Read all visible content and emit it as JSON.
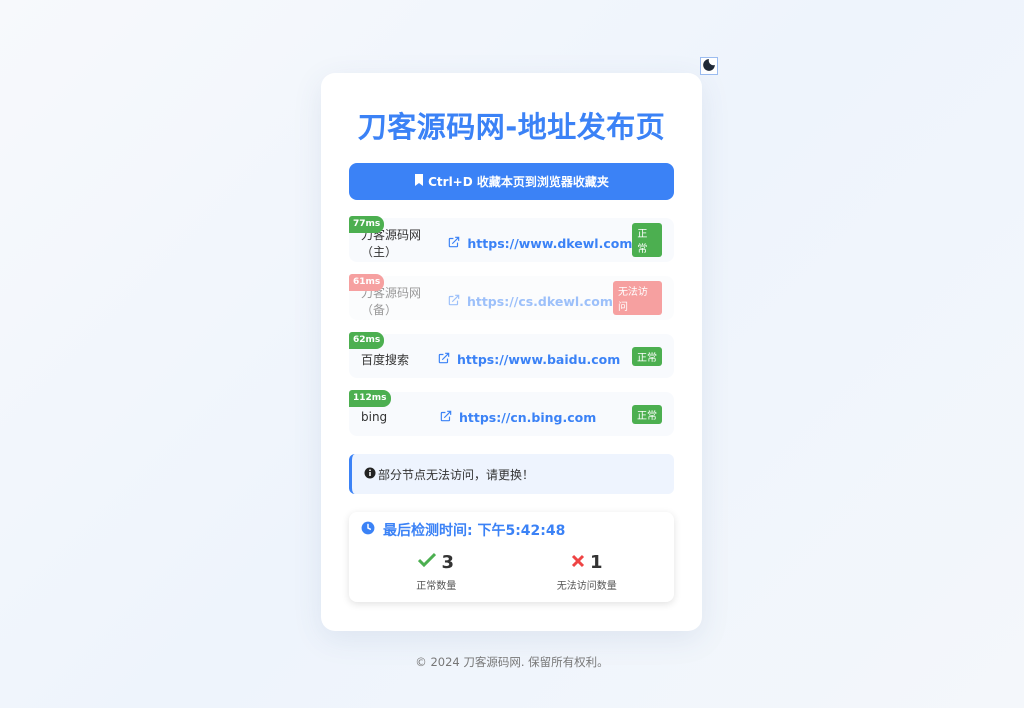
{
  "header": {
    "title": "刀客源码网-地址发布页",
    "theme_toggle_icon": "moon-icon"
  },
  "bookmark": {
    "label": "Ctrl+D 收藏本页到浏览器收藏夹",
    "icon": "bookmark-icon"
  },
  "sites": [
    {
      "latency": "77ms",
      "name": "刀客源码网（主）",
      "url": "https://www.dkewl.com",
      "status": "正常",
      "ok": true
    },
    {
      "latency": "61ms",
      "name": "刀客源码网（备）",
      "url": "https://cs.dkewl.com",
      "status": "无法访问",
      "ok": false
    },
    {
      "latency": "62ms",
      "name": "百度搜索",
      "url": "https://www.baidu.com",
      "status": "正常",
      "ok": true
    },
    {
      "latency": "112ms",
      "name": "bing",
      "url": "https://cn.bing.com",
      "status": "正常",
      "ok": true
    }
  ],
  "notice": {
    "text": "部分节点无法访问，请更换！",
    "icon": "info-circle-icon"
  },
  "check": {
    "time_label": "最后检测时间: 下午5:42:48",
    "ok_count": "3",
    "ok_label": "正常数量",
    "fail_count": "1",
    "fail_label": "无法访问数量"
  },
  "footer": {
    "text": "© 2024 刀客源码网. 保留所有权利。"
  },
  "colors": {
    "accent": "#3b82f6",
    "ok": "#4caf50",
    "fail": "#ef4444"
  }
}
